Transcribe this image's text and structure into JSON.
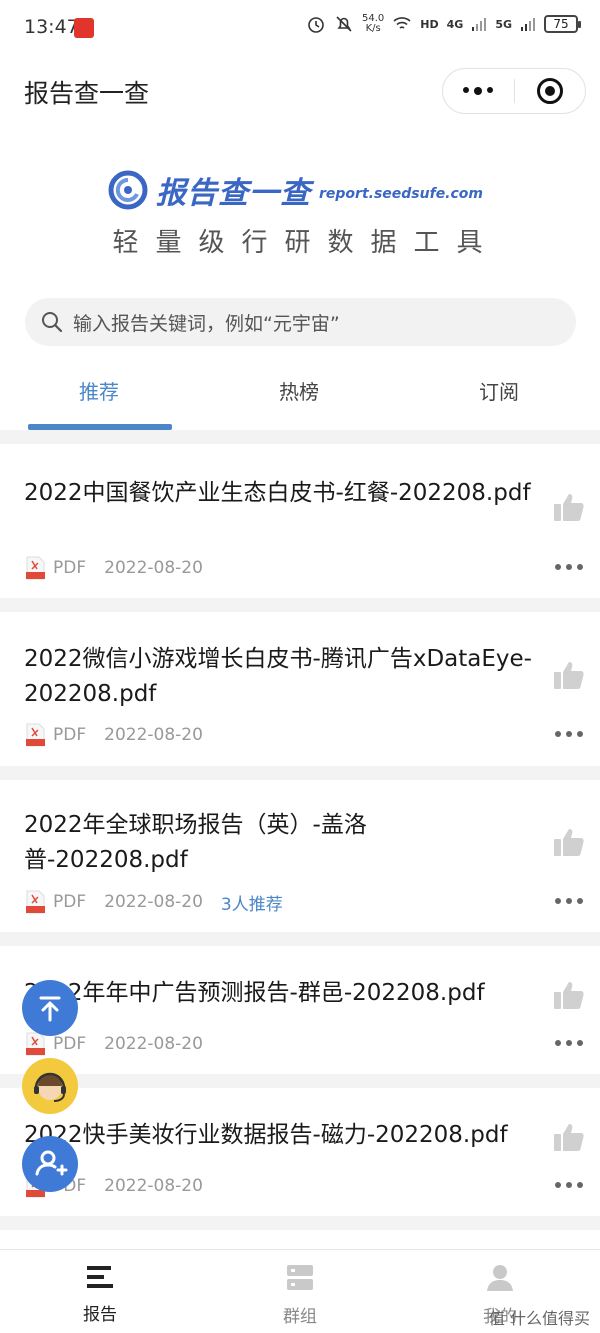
{
  "status_bar": {
    "time": "13:47",
    "net_speed_value": "54.0",
    "net_speed_unit": "K/s",
    "hd_label": "HD",
    "signal_label_1": "4G",
    "signal_label_2": "5G",
    "battery": "75"
  },
  "navbar": {
    "title": "报告查一查",
    "more_icon": "more-dots-icon",
    "close_icon": "target-circle-icon"
  },
  "brand": {
    "name": "报告查一查",
    "url": "report.seedsufe.com",
    "slogan": "轻量级行研数据工具",
    "logo_color": "#3a66c4"
  },
  "search": {
    "placeholder": "输入报告关键词，例如“元宇宙”"
  },
  "tabs": [
    {
      "label": "推荐",
      "active": true
    },
    {
      "label": "热榜",
      "active": false
    },
    {
      "label": "订阅",
      "active": false
    }
  ],
  "accent_color": "#4a86c8",
  "reports": [
    {
      "title": "2022中国餐饮产业生态白皮书-红餐-202208.pdf",
      "type": "PDF",
      "date": "2022-08-20",
      "recommend": ""
    },
    {
      "title": "2022微信小游戏增长白皮书-腾讯广告xDataEye-202208.pdf",
      "type": "PDF",
      "date": "2022-08-20",
      "recommend": ""
    },
    {
      "title": "2022年全球职场报告（英）-盖洛普-202208.pdf",
      "type": "PDF",
      "date": "2022-08-20",
      "recommend": "3人推荐"
    },
    {
      "title": "2022年年中广告预测报告-群邑-202208.pdf",
      "type": "PDF",
      "date": "2022-08-20",
      "recommend": ""
    },
    {
      "title": "2022快手美妆行业数据报告-磁力-202208.pdf",
      "type": "PDF",
      "date": "2022-08-20",
      "recommend": ""
    }
  ],
  "bottom_nav": [
    {
      "label": "报告",
      "icon": "list-icon",
      "active": true
    },
    {
      "label": "群组",
      "icon": "server-icon",
      "active": false
    },
    {
      "label": "我的",
      "icon": "person-icon",
      "active": false
    }
  ],
  "watermark": "值 什么值得买"
}
